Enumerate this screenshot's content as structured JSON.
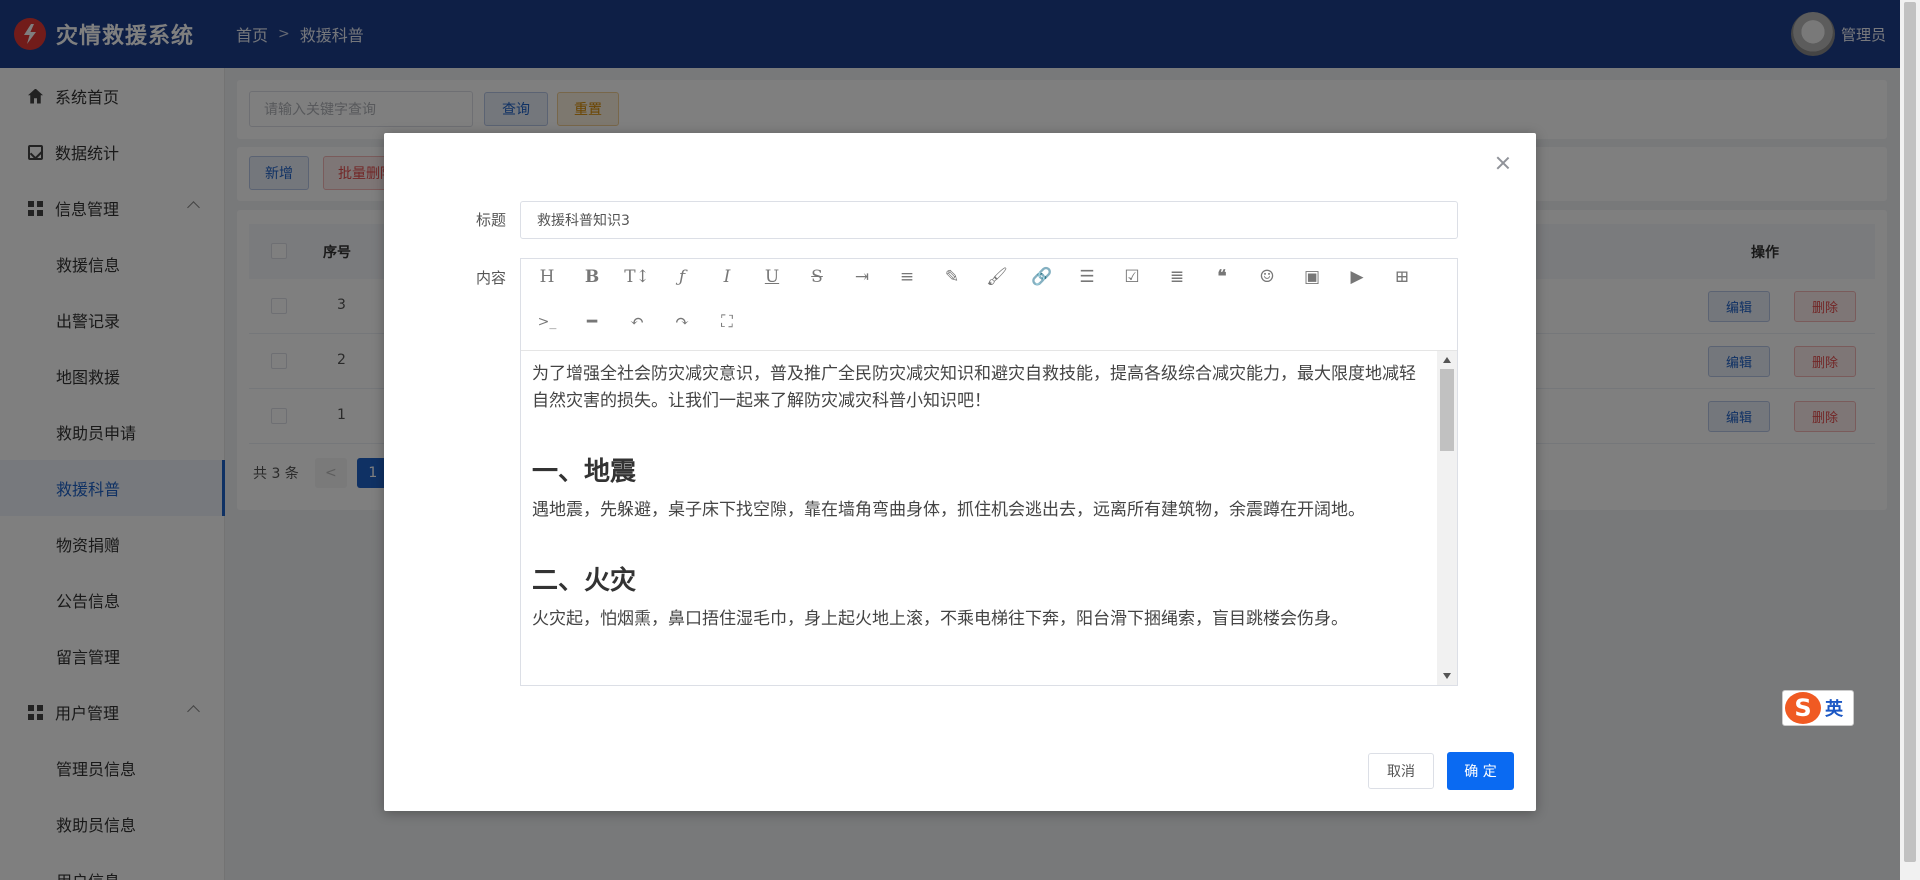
{
  "header": {
    "app_title": "灾情救援系统",
    "breadcrumb": [
      "首页",
      "救援科普"
    ],
    "user_name": "管理员"
  },
  "sidebar": {
    "items": [
      {
        "label": "系统首页",
        "icon": "home-icon"
      },
      {
        "label": "数据统计",
        "icon": "chart-icon"
      },
      {
        "label": "信息管理",
        "icon": "grid-icon",
        "expanded": true
      },
      {
        "label": "救援信息"
      },
      {
        "label": "出警记录"
      },
      {
        "label": "地图救援"
      },
      {
        "label": "救助员申请"
      },
      {
        "label": "救援科普",
        "active": true
      },
      {
        "label": "物资捐赠"
      },
      {
        "label": "公告信息"
      },
      {
        "label": "留言管理"
      },
      {
        "label": "用户管理",
        "icon": "grid-icon",
        "expanded": true
      },
      {
        "label": "管理员信息"
      },
      {
        "label": "救助员信息"
      },
      {
        "label": "用户信息"
      }
    ]
  },
  "search": {
    "placeholder": "请输入关键字查询",
    "query_label": "查询",
    "reset_label": "重置"
  },
  "toolbar": {
    "add_label": "新增",
    "batch_delete_label": "批量删除"
  },
  "table": {
    "headers": {
      "index": "序号",
      "actions": "操作"
    },
    "rows": [
      {
        "index": "3",
        "edit": "编辑",
        "delete": "删除"
      },
      {
        "index": "2",
        "edit": "编辑",
        "delete": "删除"
      },
      {
        "index": "1",
        "edit": "编辑",
        "delete": "删除"
      }
    ],
    "total_text": "共 3 条",
    "current_page": "1"
  },
  "dialog": {
    "title_label": "标题",
    "title_value": "救援科普知识3",
    "content_label": "内容",
    "toolbar_icons": [
      "heading-icon",
      "bold-icon",
      "font-size-icon",
      "font-family-icon",
      "italic-icon",
      "underline-icon",
      "strikethrough-icon",
      "indent-icon",
      "line-height-icon",
      "font-color-icon",
      "bg-color-icon",
      "link-icon",
      "bullet-list-icon",
      "todo-icon",
      "justify-icon",
      "quote-icon",
      "emoji-icon",
      "image-icon",
      "video-icon",
      "table-icon",
      "code-icon",
      "divider-icon",
      "undo-icon",
      "redo-icon",
      "fullscreen-icon"
    ],
    "content": {
      "intro": "为了增强全社会防灾减灾意识，普及推广全民防灾减灾知识和避灾自救技能，提高各级综合减灾能力，最大限度地减轻自然灾害的损失。让我们一起来了解防灾减灾科普小知识吧！",
      "h1": "一、地震",
      "p1": "遇地震，先躲避，桌子床下找空隙，靠在墙角弯曲身体，抓住机会逃出去，远离所有建筑物，余震蹲在开阔地。",
      "h2": "二、火灾",
      "p2": "火灾起，怕烟熏，鼻口捂住湿毛巾，身上起火地上滚，不乘电梯往下奔，阳台滑下捆绳索，盲目跳楼会伤身。"
    },
    "cancel_label": "取消",
    "confirm_label": "确 定"
  },
  "ime": {
    "logo": "S",
    "mode": "英"
  },
  "colors": {
    "header_bg": "#1d3e8c",
    "primary": "#1f62c9",
    "confirm": "#0a6af2",
    "danger": "#e54d4d",
    "warning": "#d68a00"
  }
}
